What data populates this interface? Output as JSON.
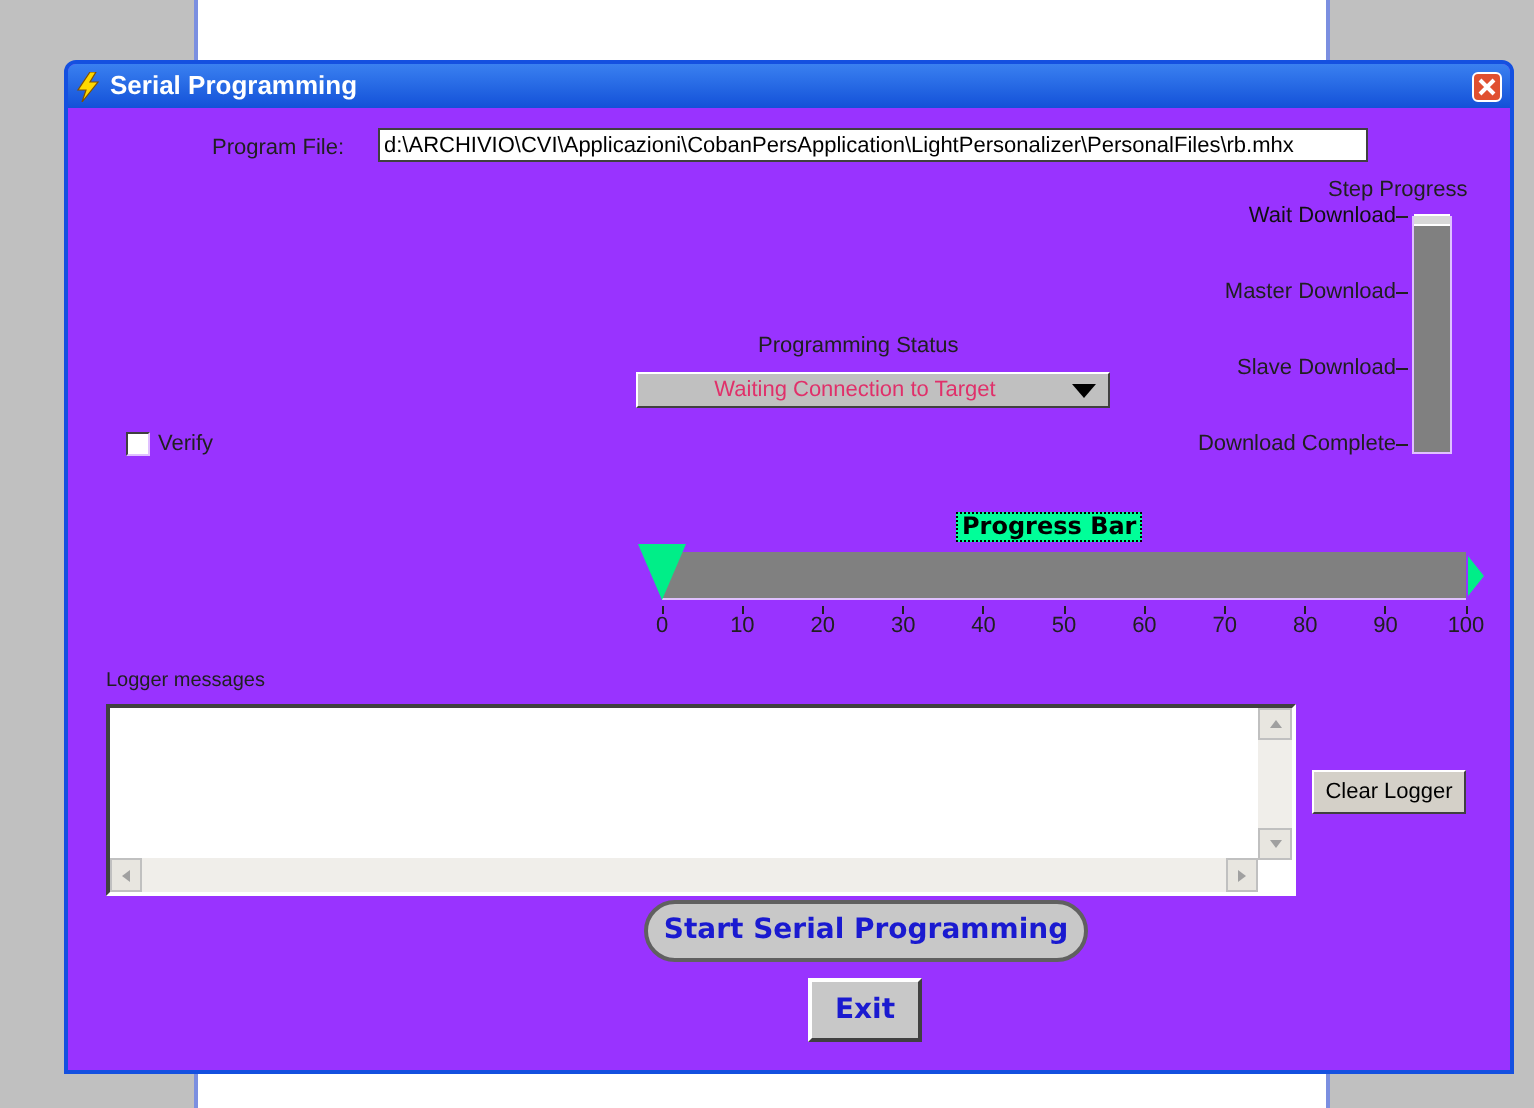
{
  "window": {
    "title": "Serial Programming"
  },
  "program_file": {
    "label": "Program File:",
    "value": "d:\\ARCHIVIO\\CVI\\Applicazioni\\CobanPersApplication\\LightPersonalizer\\PersonalFiles\\rb.mhx"
  },
  "step_progress": {
    "title": "Step Progress",
    "steps": [
      {
        "label": "Wait Download",
        "selected": true
      },
      {
        "label": "Master Download",
        "selected": false
      },
      {
        "label": "Slave Download",
        "selected": false
      },
      {
        "label": "Download Complete",
        "selected": false
      }
    ]
  },
  "programming_status": {
    "label": "Programming Status",
    "value": "Waiting Connection to Target"
  },
  "verify": {
    "label": "Verify",
    "checked": false
  },
  "progress_bar": {
    "label": "Progress Bar",
    "level": 0,
    "ticks": [
      "0",
      "10",
      "20",
      "30",
      "40",
      "50",
      "60",
      "70",
      "80",
      "90",
      "100"
    ]
  },
  "logger": {
    "label": "Logger messages"
  },
  "buttons": [
    {
      "kind": "small",
      "label": "Clear Logger"
    },
    {
      "kind": "pill",
      "label": "Start Serial Programming"
    },
    {
      "kind": "square",
      "label": "Exit"
    }
  ]
}
